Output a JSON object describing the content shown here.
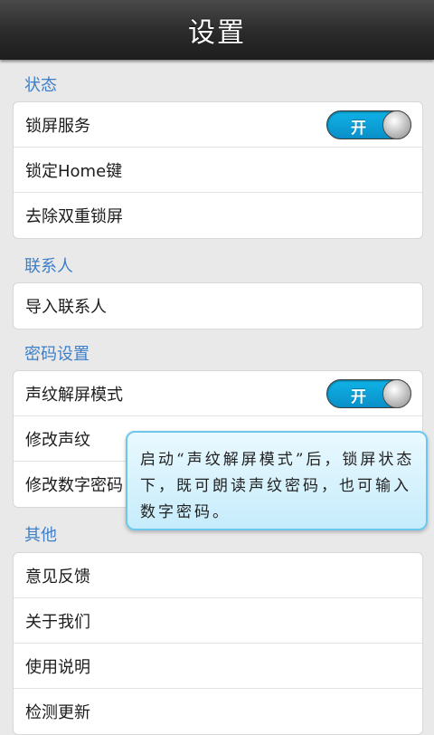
{
  "header": {
    "title": "设置"
  },
  "sections": [
    {
      "title": "状态",
      "items": [
        {
          "label": "锁屏服务",
          "toggle": "开"
        },
        {
          "label": "锁定Home键"
        },
        {
          "label": "去除双重锁屏"
        }
      ]
    },
    {
      "title": "联系人",
      "items": [
        {
          "label": "导入联系人"
        }
      ]
    },
    {
      "title": "密码设置",
      "items": [
        {
          "label": "声纹解屏模式",
          "toggle": "开"
        },
        {
          "label": "修改声纹"
        },
        {
          "label": "修改数字密码"
        }
      ]
    },
    {
      "title": "其他",
      "items": [
        {
          "label": "意见反馈"
        },
        {
          "label": "关于我们"
        },
        {
          "label": "使用说明"
        },
        {
          "label": "检测更新"
        }
      ]
    }
  ],
  "tooltip": {
    "text": "启动“声纹解屏模式”后，锁屏状态下，既可朗读声纹密码，也可输入数字密码。"
  },
  "colors": {
    "accent": "#3d7fc8",
    "toggle_on": "#0fb3e6",
    "tooltip_border": "#6cc7ee"
  }
}
